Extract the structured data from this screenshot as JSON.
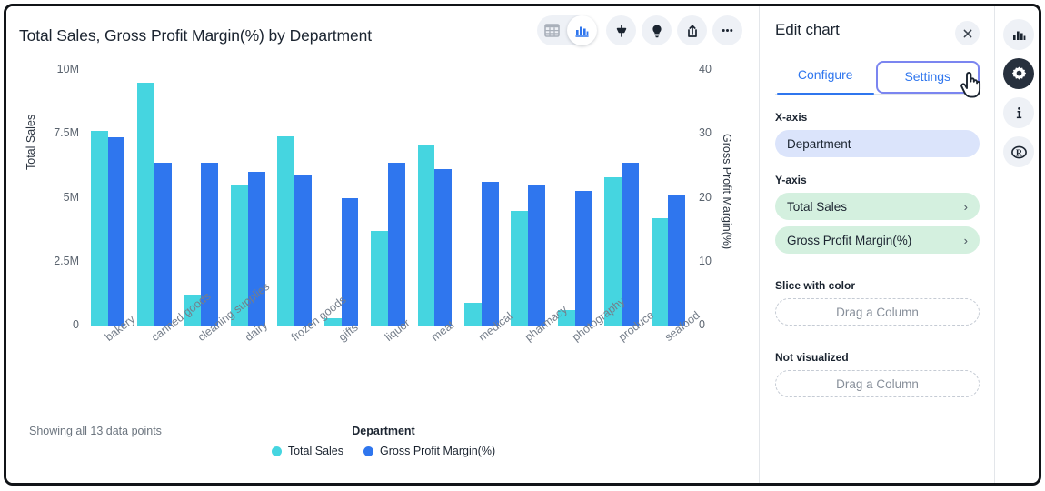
{
  "chart_panel": {
    "title": "Total Sales, Gross Profit Margin(%) by Department",
    "footer_note": "Showing all 13 data points",
    "toolbar": [
      {
        "name": "table-view-icon",
        "label": "Table view"
      },
      {
        "name": "chart-view-icon",
        "label": "Chart view"
      },
      {
        "name": "pin-icon",
        "label": "Pin"
      },
      {
        "name": "insights-icon",
        "label": "Insights"
      },
      {
        "name": "share-icon",
        "label": "Share"
      },
      {
        "name": "more-options-icon",
        "label": "More"
      }
    ]
  },
  "chart_data": {
    "type": "bar",
    "title": "Total Sales, Gross Profit Margin(%) by Department",
    "xlabel": "Department",
    "legend_title": "Department",
    "legend_position": "bottom",
    "grid": false,
    "categories": [
      "bakery",
      "canned goods",
      "cleaning supplies",
      "dairy",
      "frozen goods",
      "gifts",
      "liquor",
      "meat",
      "medical",
      "pharmacy",
      "photography",
      "produce",
      "seafood"
    ],
    "series": [
      {
        "name": "Total Sales",
        "color": "#45d5e0",
        "axis": "left",
        "ylabel": "Total Sales",
        "ylim": [
          0,
          10000000
        ],
        "ticks": [
          0,
          2500000,
          5000000,
          7500000,
          10000000
        ],
        "tick_labels": [
          "0",
          "2.5M",
          "5M",
          "7.5M",
          "10M"
        ],
        "values": [
          7600000,
          9500000,
          1200000,
          5500000,
          7400000,
          300000,
          3700000,
          7100000,
          900000,
          4500000,
          600000,
          5800000,
          4200000
        ]
      },
      {
        "name": "Gross Profit Margin(%)",
        "color": "#2f76ee",
        "axis": "right",
        "ylabel": "Gross Profit Margin(%)",
        "ylim": [
          0,
          40
        ],
        "ticks": [
          0,
          10,
          20,
          30,
          40
        ],
        "tick_labels": [
          "0",
          "10",
          "20",
          "30",
          "40"
        ],
        "values": [
          29.5,
          25.5,
          25.5,
          24.0,
          23.5,
          20.0,
          25.5,
          24.5,
          22.5,
          22.0,
          21.0,
          25.5,
          20.5
        ]
      }
    ]
  },
  "edit_panel": {
    "title": "Edit chart",
    "close_label": "×",
    "tabs": [
      {
        "label": "Configure",
        "state": "active"
      },
      {
        "label": "Settings",
        "state": "focused"
      }
    ],
    "x_axis": {
      "label": "X-axis",
      "value": "Department"
    },
    "y_axis": {
      "label": "Y-axis",
      "values": [
        "Total Sales",
        "Gross Profit Margin(%)"
      ],
      "chevron": "›"
    },
    "slice_with_color": {
      "label": "Slice with color",
      "placeholder": "Drag a Column"
    },
    "not_visualized": {
      "label": "Not visualized",
      "placeholder": "Drag a Column"
    }
  },
  "rail": [
    {
      "name": "chart-icon",
      "label": "Chart",
      "state": "inactive"
    },
    {
      "name": "gear-icon",
      "label": "Settings",
      "state": "active"
    },
    {
      "name": "info-icon",
      "label": "Info",
      "state": "inactive"
    },
    {
      "name": "r-icon",
      "label": "R",
      "state": "inactive"
    }
  ],
  "colors": {
    "series1": "#45d5e0",
    "series2": "#2f76ee",
    "accent": "#2f76ee",
    "focus_ring": "#7b85f0",
    "pill_blue": "#dbe4fb",
    "pill_green": "#d4f0df"
  }
}
